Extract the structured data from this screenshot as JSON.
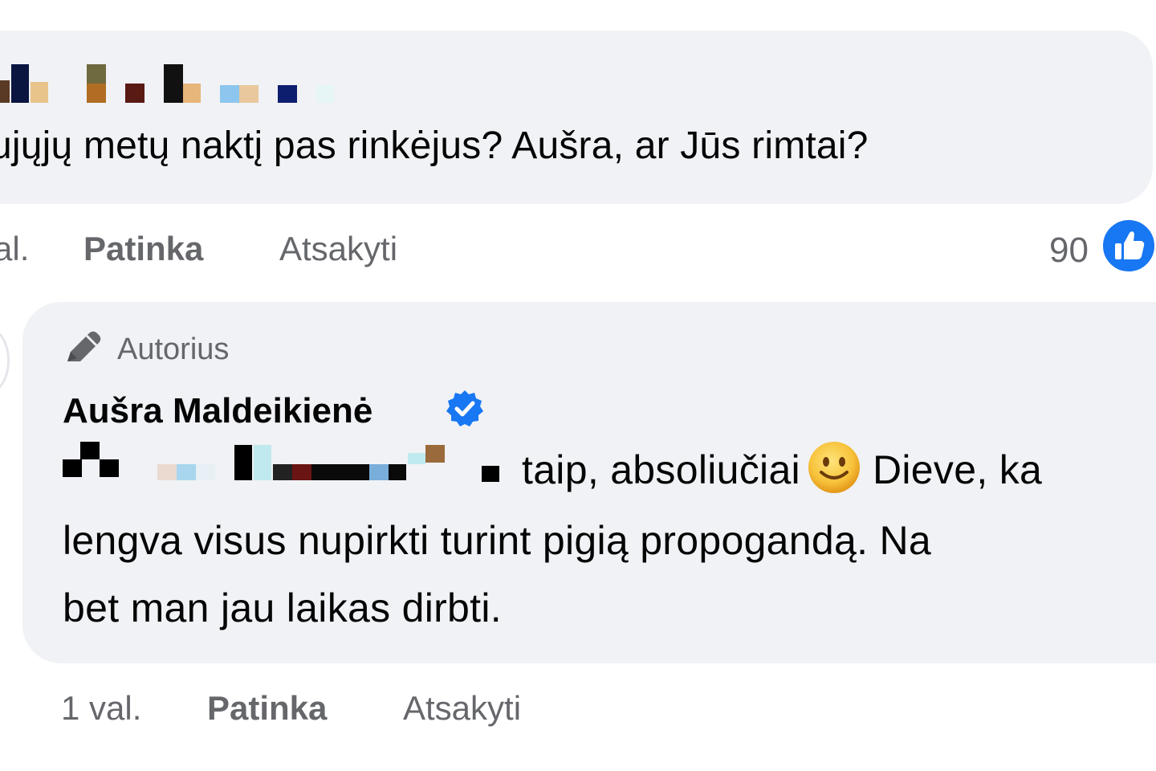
{
  "parent_comment": {
    "author_name_redacted": true,
    "text": "ujųjų metų naktį pas rinkėjus? Aušra, ar Jūs rimtai?",
    "time": "al.",
    "like_label": "Patinka",
    "reply_label": "Atsakyti",
    "reaction_count": "90",
    "reaction_icon": "like-icon",
    "colors": {
      "bubble": "#f0f2f5",
      "reaction": "#1877f2"
    }
  },
  "reply": {
    "badge_icon": "pencil-icon",
    "badge_label": "Autorius",
    "author_name": "Aušra Maldeikienė",
    "verified_icon": "verified-badge-icon",
    "mention_redacted": true,
    "line1_text": "taip, absoliučiai",
    "emoji": "smiley-emoji-icon",
    "line1_tail": "Dieve, ka",
    "line2": "lengva visus nupirkti turint pigią propogandą. Na",
    "line3": "bet man jau laikas dirbti.",
    "time": "1 val.",
    "like_label": "Patinka",
    "reply_label": "Atsakyti"
  }
}
